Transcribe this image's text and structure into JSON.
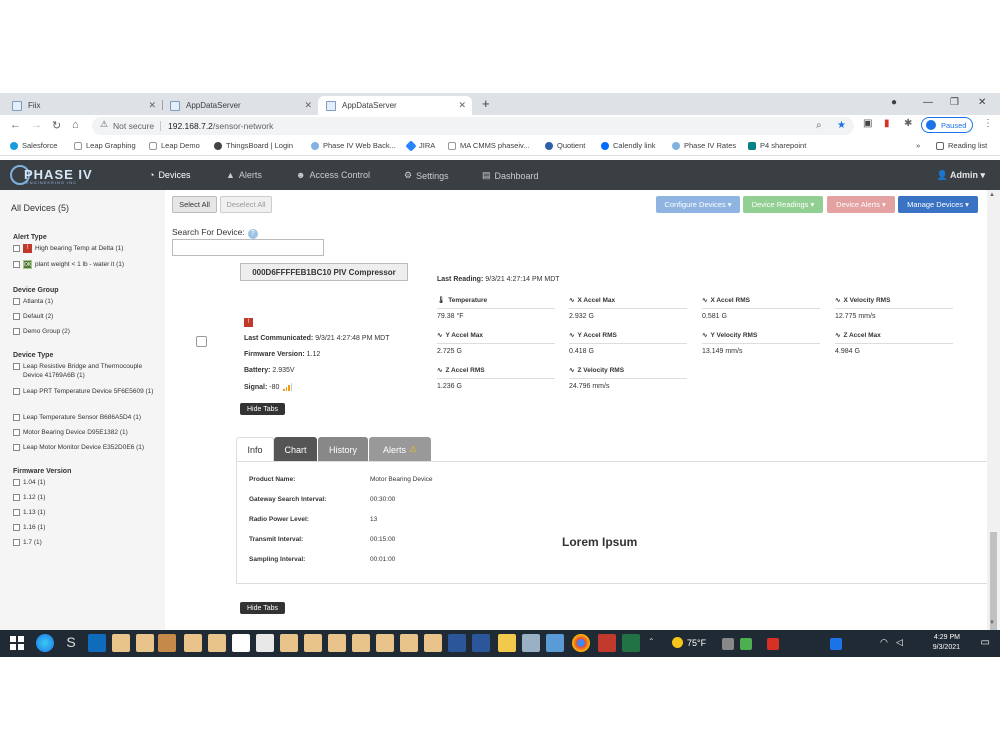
{
  "browser": {
    "tabs": [
      {
        "title": "Fiix"
      },
      {
        "title": "AppDataServer"
      },
      {
        "title": "AppDataServer"
      }
    ],
    "new_tab": "+",
    "address": {
      "security": "Not secure",
      "host": "192.168.7.2",
      "path": "/sensor-network"
    },
    "paused_label": "Paused",
    "bookmarks": [
      "Salesforce",
      "Leap Graphing",
      "Leap Demo",
      "ThingsBoard | Login",
      "Phase IV Web Back...",
      "JIRA",
      "MA CMMS phaseiv...",
      "Quotient",
      "Calendly link",
      "Phase IV Rates",
      "P4 sharepoint"
    ],
    "more_bookmarks": "»",
    "reading_list": "Reading list"
  },
  "nav": {
    "logo_text": "PHASE IV",
    "logo_sub": "ENGINEERING INC",
    "items": [
      {
        "label": "Devices",
        "icon": "dashboard-icon"
      },
      {
        "label": "Alerts",
        "icon": "warning-icon"
      },
      {
        "label": "Access Control",
        "icon": "users-icon"
      },
      {
        "label": "Settings",
        "icon": "gear-icon"
      },
      {
        "label": "Dashboard",
        "icon": "book-icon"
      }
    ],
    "admin": "Admin"
  },
  "sidebar": {
    "title": "All Devices (5)",
    "alert_type": {
      "heading": "Alert Type",
      "items": [
        "High bearing Temp at Delta (1)",
        "plant weight < 1 lb - water it (1)"
      ]
    },
    "device_group": {
      "heading": "Device Group",
      "items": [
        "Atlanta (1)",
        "Default (2)",
        "Demo Group (2)"
      ]
    },
    "device_type": {
      "heading": "Device Type",
      "items": [
        "Leap Resistive Bridge and Thermocouple Device 41769A6B (1)",
        "Leap PRT Temperature Device 5F6E5609 (1)",
        "Leap Temperature Sensor B686A5D4 (1)",
        "Motor Bearing Device D95E1382 (1)",
        "Leap Motor Monitor Device E352D0E6 (1)"
      ]
    },
    "firmware_version": {
      "heading": "Firmware Version",
      "items": [
        "1.04 (1)",
        "1.12 (1)",
        "1.13 (1)",
        "1.16 (1)",
        "1.7 (1)"
      ]
    }
  },
  "toolbar": {
    "select_all": "Select All",
    "deselect_all": "Deselect All",
    "configure_devices": "Configure Devices",
    "device_readings": "Device Readings",
    "device_alerts": "Device Alerts",
    "manage_devices": "Manage Devices"
  },
  "search": {
    "label": "Search For Device:",
    "help": "?",
    "value": ""
  },
  "device": {
    "name": "000D6FFFFEB1BC10 PIV Compressor",
    "last_communicated_label": "Last Communicated:",
    "last_communicated": "9/3/21 4:27:48 PM  MDT",
    "firmware_label": "Firmware Version:",
    "firmware": "1.12",
    "battery_label": "Battery:",
    "battery": "2.935V",
    "signal_label": "Signal:",
    "signal": "-80",
    "hide_tabs": "Hide Tabs",
    "last_reading_label": "Last Reading:",
    "last_reading": "9/3/21 4:27:14 PM  MDT",
    "metrics": [
      {
        "label": "Temperature",
        "value": "79.38 °F",
        "icon": "thermometer-icon"
      },
      {
        "label": "X Accel Max",
        "value": "2.932 G",
        "icon": "wave-icon"
      },
      {
        "label": "X Accel RMS",
        "value": "0.581 G",
        "icon": "wave-icon"
      },
      {
        "label": "X Velocity RMS",
        "value": "12.775 mm/s",
        "icon": "wave-icon"
      },
      {
        "label": "Y Accel Max",
        "value": "2.725 G",
        "icon": "wave-icon"
      },
      {
        "label": "Y Accel RMS",
        "value": "0.418 G",
        "icon": "wave-icon"
      },
      {
        "label": "Y Velocity RMS",
        "value": "13.149 mm/s",
        "icon": "wave-icon"
      },
      {
        "label": "Z Accel Max",
        "value": "4.984 G",
        "icon": "wave-icon"
      },
      {
        "label": "Z Accel RMS",
        "value": "1.236 G",
        "icon": "wave-icon"
      },
      {
        "label": "Z Velocity RMS",
        "value": "24.796 mm/s",
        "icon": "wave-icon"
      }
    ]
  },
  "tabs": {
    "info": "Info",
    "chart": "Chart",
    "history": "History",
    "alerts": "Alerts",
    "active": "Info"
  },
  "info_panel": {
    "rows": [
      {
        "label": "Product Name:",
        "value": "Motor Bearing Device"
      },
      {
        "label": "Gateway Search Interval:",
        "value": "00:30:00"
      },
      {
        "label": "Radio Power Level:",
        "value": "13"
      },
      {
        "label": "Transmit Interval:",
        "value": "00:15:00"
      },
      {
        "label": "Sampling Interval:",
        "value": "00:01:00"
      }
    ],
    "lorem": "Lorem Ipsum"
  },
  "taskbar": {
    "weather": "75°F",
    "time": "4:29 PM",
    "date": "9/3/2021"
  },
  "colors": {
    "nav_bg": "#3a3f44",
    "sidebar_bg": "#f5f5f5",
    "configure": "#8fb4e1",
    "readings": "#92cf92",
    "alerts": "#e3a1a1",
    "manage": "#3a72c4"
  }
}
